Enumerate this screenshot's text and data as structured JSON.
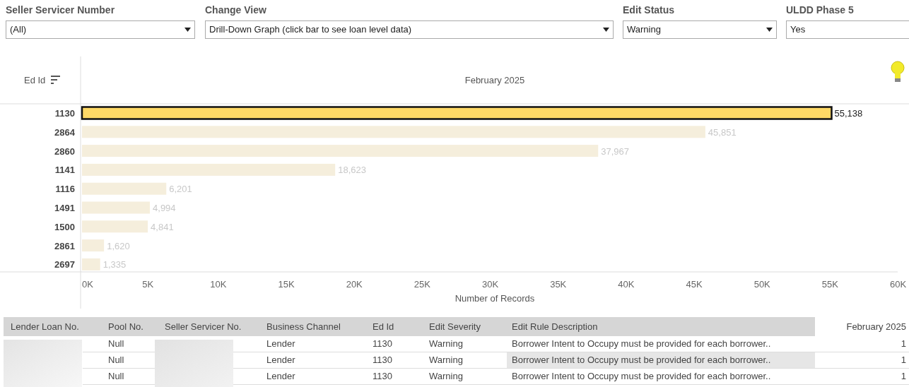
{
  "filters": [
    {
      "label": "Seller Servicer Number",
      "value": "(All)",
      "has_arrow": true
    },
    {
      "label": "Change View",
      "value": "Drill-Down Graph (click bar to see loan level data)",
      "has_arrow": true
    },
    {
      "label": "Edit Status",
      "value": "Warning",
      "has_arrow": true
    },
    {
      "label": "ULDD Phase 5",
      "value": "Yes",
      "has_arrow": false
    }
  ],
  "chart": {
    "row_header": "Ed Id",
    "column_header": "February 2025",
    "selected_bars": [
      true,
      false,
      false,
      false,
      false,
      false,
      false,
      false,
      false
    ],
    "chart_data": {
      "type": "bar",
      "orientation": "horizontal",
      "xlabel": "Number of Records",
      "categories": [
        "1130",
        "2864",
        "2860",
        "1141",
        "1116",
        "1491",
        "1500",
        "2861",
        "2697"
      ],
      "values": [
        55138,
        45851,
        37967,
        18623,
        6201,
        4994,
        4841,
        1620,
        1335
      ],
      "value_labels": [
        "55,138",
        "45,851",
        "37,967",
        "18,623",
        "6,201",
        "4,994",
        "4,841",
        "1,620",
        "1,335"
      ],
      "xlim": [
        0,
        60000
      ],
      "xticks": [
        {
          "value": 0,
          "label": "0K"
        },
        {
          "value": 5000,
          "label": "5K"
        },
        {
          "value": 10000,
          "label": "10K"
        },
        {
          "value": 15000,
          "label": "15K"
        },
        {
          "value": 20000,
          "label": "20K"
        },
        {
          "value": 25000,
          "label": "25K"
        },
        {
          "value": 30000,
          "label": "30K"
        },
        {
          "value": 35000,
          "label": "35K"
        },
        {
          "value": 40000,
          "label": "40K"
        },
        {
          "value": 45000,
          "label": "45K"
        },
        {
          "value": 50000,
          "label": "50K"
        },
        {
          "value": 55000,
          "label": "55K"
        },
        {
          "value": 60000,
          "label": "60K"
        }
      ]
    }
  },
  "table": {
    "columns": [
      "Lender Loan No.",
      "Pool No.",
      "Seller Servicer No.",
      "Business Channel",
      "Ed Id",
      "Edit Severity",
      "Edit Rule Description",
      "February 2025"
    ],
    "rows": [
      {
        "pool_no": "Null",
        "business_channel": "Lender",
        "ed_id": "1130",
        "edit_severity": "Warning",
        "edit_rule_description": "Borrower Intent to Occupy must be provided for each borrower..",
        "count": "1",
        "hovered": false
      },
      {
        "pool_no": "Null",
        "business_channel": "Lender",
        "ed_id": "1130",
        "edit_severity": "Warning",
        "edit_rule_description": "Borrower Intent to Occupy must be provided for each borrower..",
        "count": "1",
        "hovered": true
      },
      {
        "pool_no": "Null",
        "business_channel": "Lender",
        "ed_id": "1130",
        "edit_severity": "Warning",
        "edit_rule_description": "Borrower Intent to Occupy must be provided for each borrower..",
        "count": "1",
        "hovered": false
      }
    ]
  }
}
